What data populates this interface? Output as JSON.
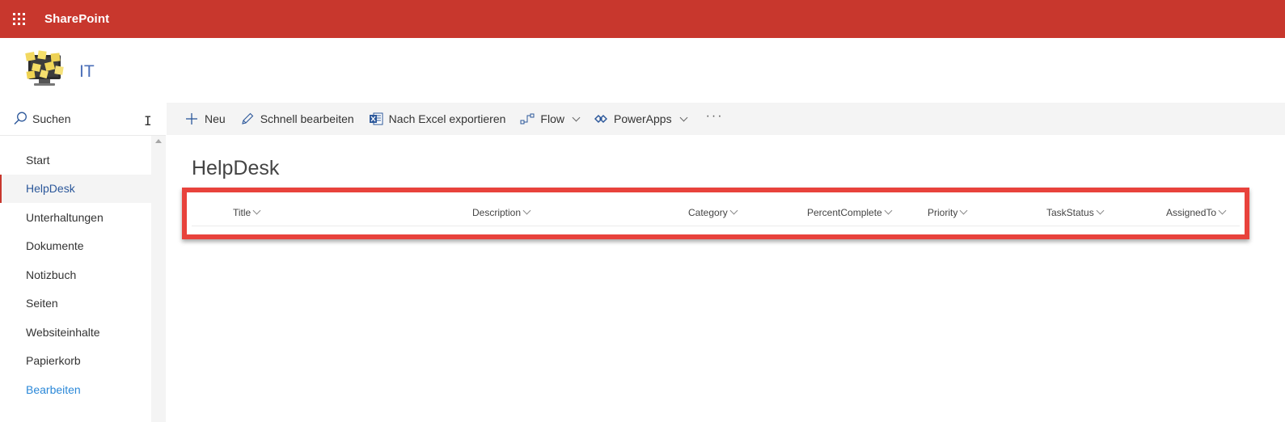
{
  "suite": {
    "brand": "SharePoint"
  },
  "site": {
    "title": "IT"
  },
  "search": {
    "placeholder": "Suchen"
  },
  "nav": {
    "items": [
      {
        "label": "Start",
        "selected": false
      },
      {
        "label": "HelpDesk",
        "selected": true
      },
      {
        "label": "Unterhaltungen",
        "selected": false
      },
      {
        "label": "Dokumente",
        "selected": false
      },
      {
        "label": "Notizbuch",
        "selected": false
      },
      {
        "label": "Seiten",
        "selected": false
      },
      {
        "label": "Websiteinhalte",
        "selected": false
      },
      {
        "label": "Papierkorb",
        "selected": false
      },
      {
        "label": "Bearbeiten",
        "selected": false,
        "is_edit_link": true
      }
    ]
  },
  "commands": {
    "new": "Neu",
    "quick_edit": "Schnell bearbeiten",
    "export_excel": "Nach Excel exportieren",
    "flow": "Flow",
    "powerapps": "PowerApps",
    "more": "···"
  },
  "list": {
    "title": "HelpDesk",
    "columns": [
      "Title",
      "Description",
      "Category",
      "PercentComplete",
      "Priority",
      "TaskStatus",
      "AssignedTo"
    ]
  },
  "colors": {
    "suite_bar": "#c8372d",
    "highlight": "#e8423c",
    "accent_link": "#2b88d8",
    "site_title": "#4b6fb8"
  }
}
